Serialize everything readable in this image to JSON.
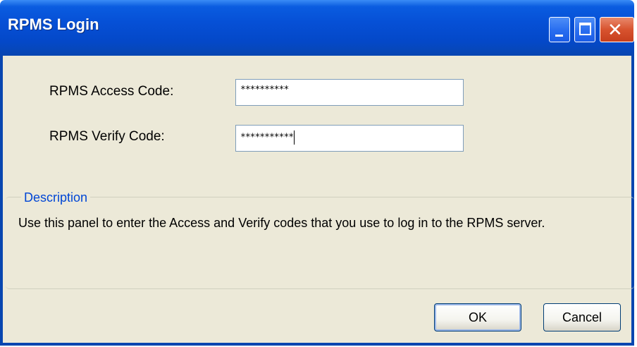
{
  "window": {
    "title": "RPMS Login",
    "controls": [
      "minimize-icon",
      "maximize-icon",
      "close-icon"
    ]
  },
  "form": {
    "access_label": "RPMS Access Code:",
    "access_value": "**********",
    "verify_label": "RPMS Verify Code:",
    "verify_value": "***********"
  },
  "description": {
    "title": "Description",
    "text": "Use this panel to enter the Access and Verify codes that you use to log in to the RPMS server."
  },
  "buttons": {
    "ok": "OK",
    "cancel": "Cancel"
  },
  "colors": {
    "titlebar": "#0650d6",
    "client": "#ece9d8",
    "group_title": "#0046d5",
    "close_button": "#d8532f"
  }
}
